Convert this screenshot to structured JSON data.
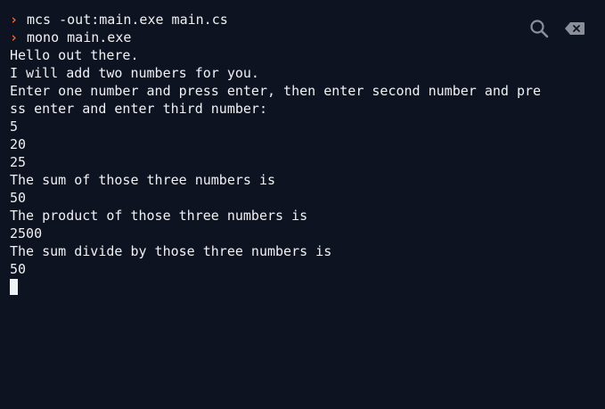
{
  "colors": {
    "background": "#0e1321",
    "text": "#f0f1f4",
    "prompt": "#f26b3a",
    "icon": "#8a8f99"
  },
  "icons": {
    "search": "search-icon",
    "clear": "clear-console-icon"
  },
  "prompt_symbol": "›",
  "commands": [
    "mcs -out:main.exe main.cs",
    "mono main.exe"
  ],
  "output": [
    "Hello out there.",
    "I will add two numbers for you.",
    "Enter one number and press enter, then enter second number and pre",
    "ss enter and enter third number:",
    "5",
    "20",
    "25",
    "The sum of those three numbers is",
    "50",
    "The product of those three numbers is",
    "2500",
    "The sum divide by those three numbers is",
    "50"
  ]
}
